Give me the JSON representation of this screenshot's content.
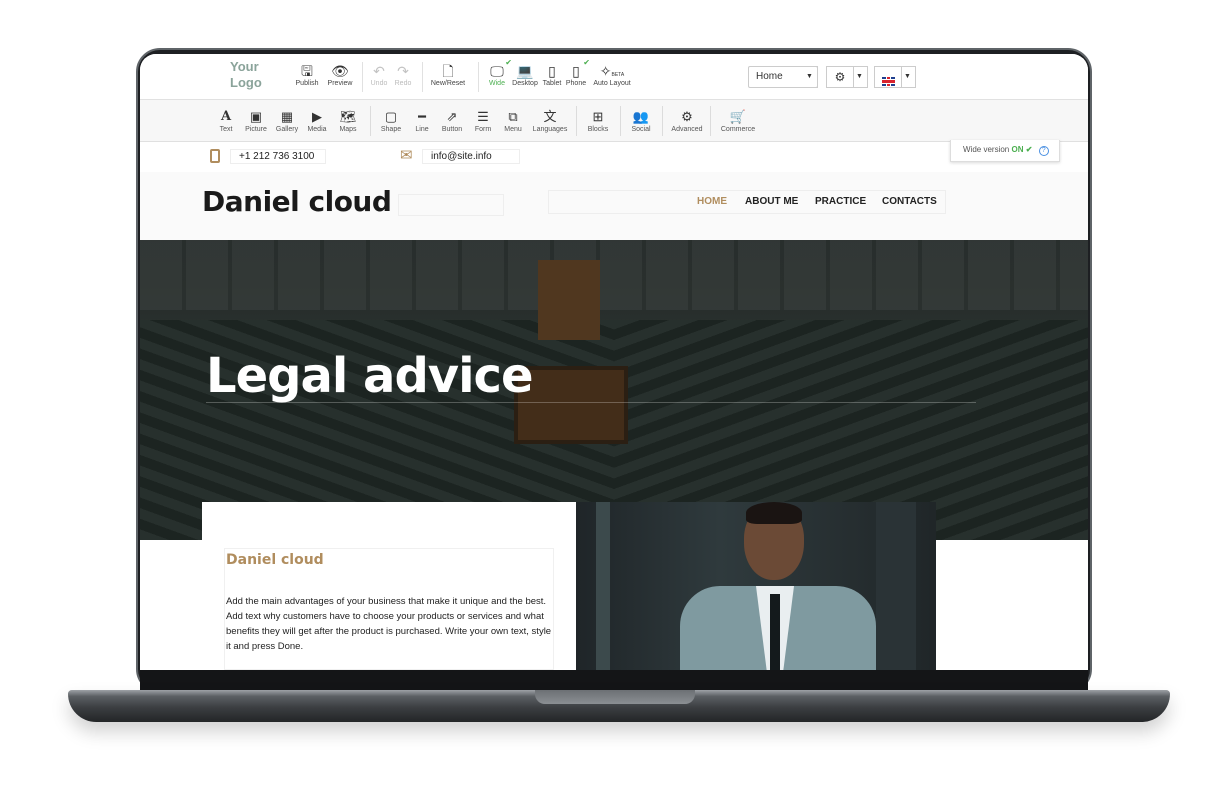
{
  "editor": {
    "logo": "Your Logo",
    "toolbar": [
      {
        "label": "Publish",
        "icon": "save-icon",
        "glyph": "🖫"
      },
      {
        "label": "Preview",
        "icon": "eye-icon",
        "glyph": "👁"
      },
      {
        "label": "Undo",
        "icon": "undo-icon",
        "glyph": "↶"
      },
      {
        "label": "Redo",
        "icon": "redo-icon",
        "glyph": "↷"
      },
      {
        "label": "New/Reset",
        "icon": "file-icon",
        "glyph": "🗋"
      },
      {
        "label": "Wide",
        "icon": "monitor-icon",
        "glyph": "🖵"
      },
      {
        "label": "Desktop",
        "icon": "laptop-icon",
        "glyph": "💻"
      },
      {
        "label": "Tablet",
        "icon": "tablet-icon",
        "glyph": "▯"
      },
      {
        "label": "Phone",
        "icon": "phone-icon",
        "glyph": "▯"
      },
      {
        "label": "Auto Layout",
        "icon": "magic-wand-icon",
        "glyph": "✧",
        "tag": "BETA"
      }
    ],
    "page_select": "Home",
    "toolbar2": [
      {
        "label": "Text",
        "icon": "text-icon",
        "glyph": "A"
      },
      {
        "label": "Picture",
        "icon": "picture-icon",
        "glyph": "▣"
      },
      {
        "label": "Gallery",
        "icon": "gallery-icon",
        "glyph": "▦"
      },
      {
        "label": "Media",
        "icon": "media-icon",
        "glyph": "▶"
      },
      {
        "label": "Maps",
        "icon": "map-icon",
        "glyph": "🗺"
      },
      {
        "label": "Shape",
        "icon": "shape-icon",
        "glyph": "▢"
      },
      {
        "label": "Line",
        "icon": "line-icon",
        "glyph": "━"
      },
      {
        "label": "Button",
        "icon": "button-icon",
        "glyph": "⇗"
      },
      {
        "label": "Form",
        "icon": "form-icon",
        "glyph": "☰"
      },
      {
        "label": "Menu",
        "icon": "menu-icon",
        "glyph": "⧉"
      },
      {
        "label": "Languages",
        "icon": "languages-icon",
        "glyph": "文"
      },
      {
        "label": "Blocks",
        "icon": "blocks-icon",
        "glyph": "⊞"
      },
      {
        "label": "Social",
        "icon": "social-icon",
        "glyph": "👥"
      },
      {
        "label": "Advanced",
        "icon": "advanced-icon",
        "glyph": "⚙"
      },
      {
        "label": "Commerce",
        "icon": "cart-icon",
        "glyph": "🛒"
      }
    ]
  },
  "site": {
    "phone": "+1 212 736 3100",
    "email": "info@site.info",
    "wide_version": {
      "label": "Wide version",
      "state": "ON"
    },
    "brand": "Daniel cloud",
    "nav": [
      "HOME",
      "ABOUT ME",
      "PRACTICE",
      "CONTACTS"
    ],
    "hero_title": "Legal advice",
    "card": {
      "title": "Daniel cloud",
      "text": "Add the main advantages of your business that make it unique and the best. Add text why customers have to choose your products or services and what benefits they will get after the product is purchased. Write your own text, style it and press Done."
    }
  },
  "colors": {
    "accent": "#b08d5e",
    "active": "#4caf50"
  }
}
